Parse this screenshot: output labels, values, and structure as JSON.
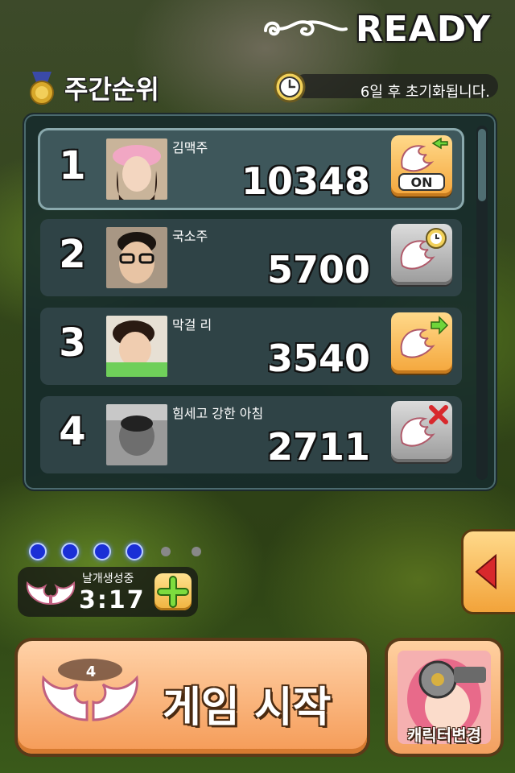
{
  "header": {
    "status": "READY"
  },
  "ranking": {
    "title": "주간순위",
    "reset_notice": "6일 후 초기화됩니다.",
    "rows": [
      {
        "rank": "1",
        "name": "김맥주",
        "score": "10348",
        "action_icon": "wing-on-icon",
        "action_label": "ON"
      },
      {
        "rank": "2",
        "name": "국소주",
        "score": "5700",
        "action_icon": "wing-timer-icon"
      },
      {
        "rank": "3",
        "name": "막걸 리",
        "score": "3540",
        "action_icon": "wing-send-icon"
      },
      {
        "rank": "4",
        "name": "힘세고 강한 아침",
        "score": "2711",
        "action_icon": "wing-blocked-icon"
      }
    ]
  },
  "pagination": {
    "total": 6,
    "active": 4
  },
  "wings": {
    "label": "날개생성중",
    "timer": "3:17",
    "count": "4"
  },
  "buttons": {
    "start_label": "게임 시작",
    "character_label": "캐릭터변경"
  },
  "colors": {
    "accent_orange": "#f59b57",
    "dot_active": "#1a2fd6",
    "panel": "#14282d"
  }
}
